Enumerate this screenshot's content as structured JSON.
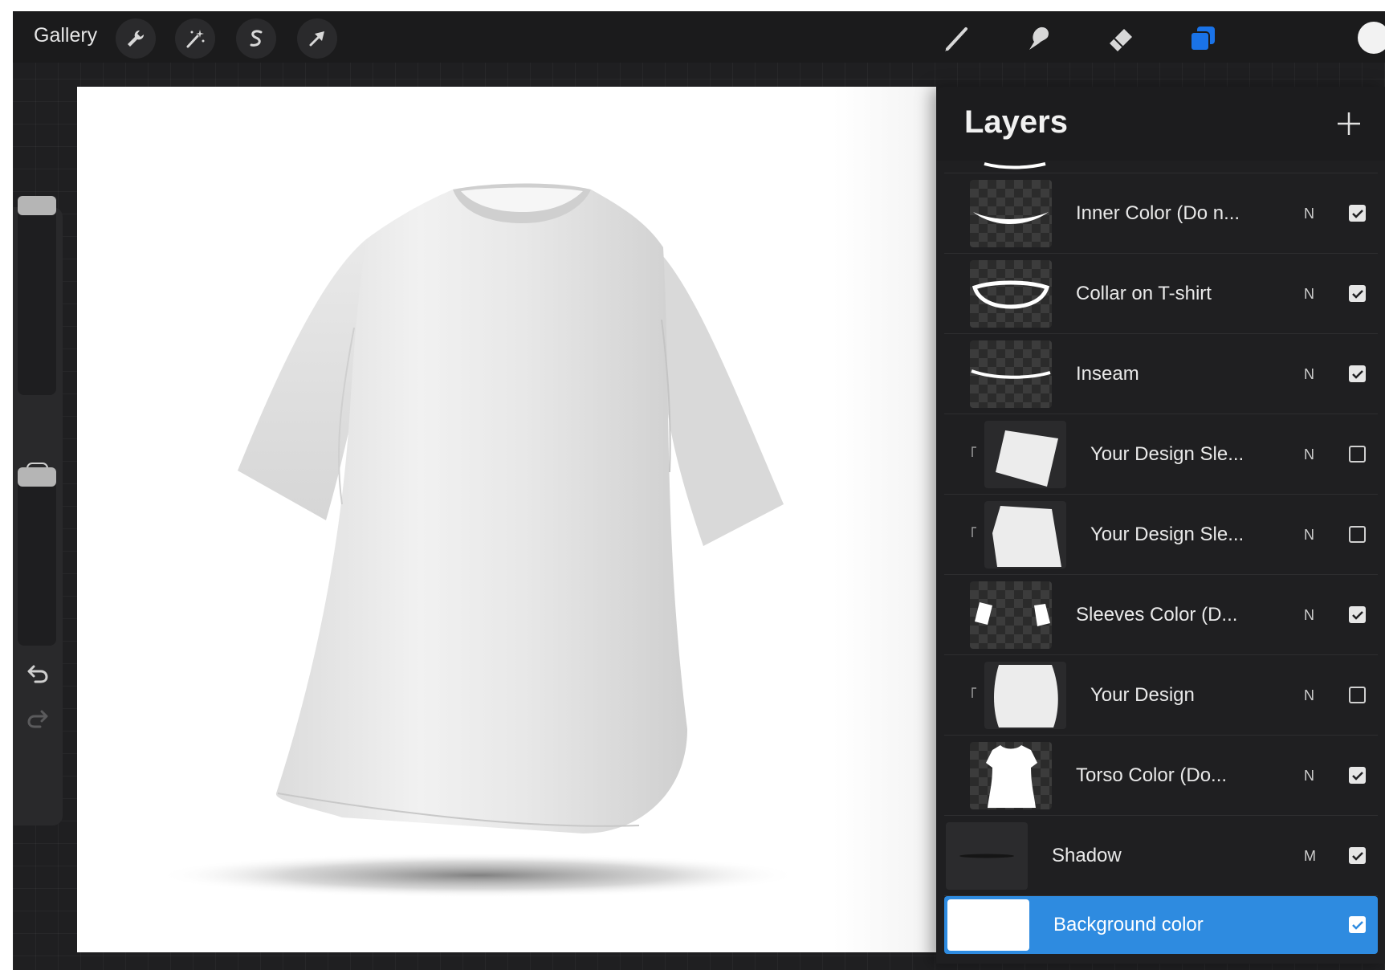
{
  "toolbar": {
    "gallery_label": "Gallery",
    "left_tools": [
      {
        "name": "actions",
        "icon": "wrench-icon"
      },
      {
        "name": "adjustments",
        "icon": "magic-wand-icon"
      },
      {
        "name": "selection",
        "icon": "selection-s-icon"
      },
      {
        "name": "transform",
        "icon": "arrow-cursor-icon"
      }
    ],
    "right_tools": [
      {
        "name": "brush",
        "icon": "brush-icon"
      },
      {
        "name": "smudge",
        "icon": "smudge-icon"
      },
      {
        "name": "eraser",
        "icon": "eraser-icon"
      },
      {
        "name": "layers",
        "icon": "layers-icon",
        "active": true,
        "color": "#1a73e8"
      }
    ],
    "color_swatch": "#f2f2f2"
  },
  "sidebar": {
    "brush_size_slider": {
      "value": 1.0
    },
    "opacity_slider": {
      "value": 1.0
    },
    "icons": [
      "modify-square-icon",
      "undo-icon",
      "redo-icon"
    ]
  },
  "layers": {
    "title": "Layers",
    "items": [
      {
        "name": "Inner Color (Do n...",
        "blend": "N",
        "visible": true,
        "clipped": false
      },
      {
        "name": "Collar on T-shirt",
        "blend": "N",
        "visible": true,
        "clipped": false
      },
      {
        "name": "Inseam",
        "blend": "N",
        "visible": true,
        "clipped": false
      },
      {
        "name": "Your Design Sle...",
        "blend": "N",
        "visible": false,
        "clipped": true
      },
      {
        "name": "Your Design Sle...",
        "blend": "N",
        "visible": false,
        "clipped": true
      },
      {
        "name": "Sleeves Color (D...",
        "blend": "N",
        "visible": true,
        "clipped": false
      },
      {
        "name": "Your Design",
        "blend": "N",
        "visible": false,
        "clipped": true
      },
      {
        "name": "Torso Color (Do...",
        "blend": "N",
        "visible": true,
        "clipped": false
      },
      {
        "name": "Shadow",
        "blend": "M",
        "visible": true,
        "clipped": false
      }
    ],
    "background": {
      "name": "Background color",
      "visible": true,
      "active_color": "#2e8be0"
    }
  }
}
